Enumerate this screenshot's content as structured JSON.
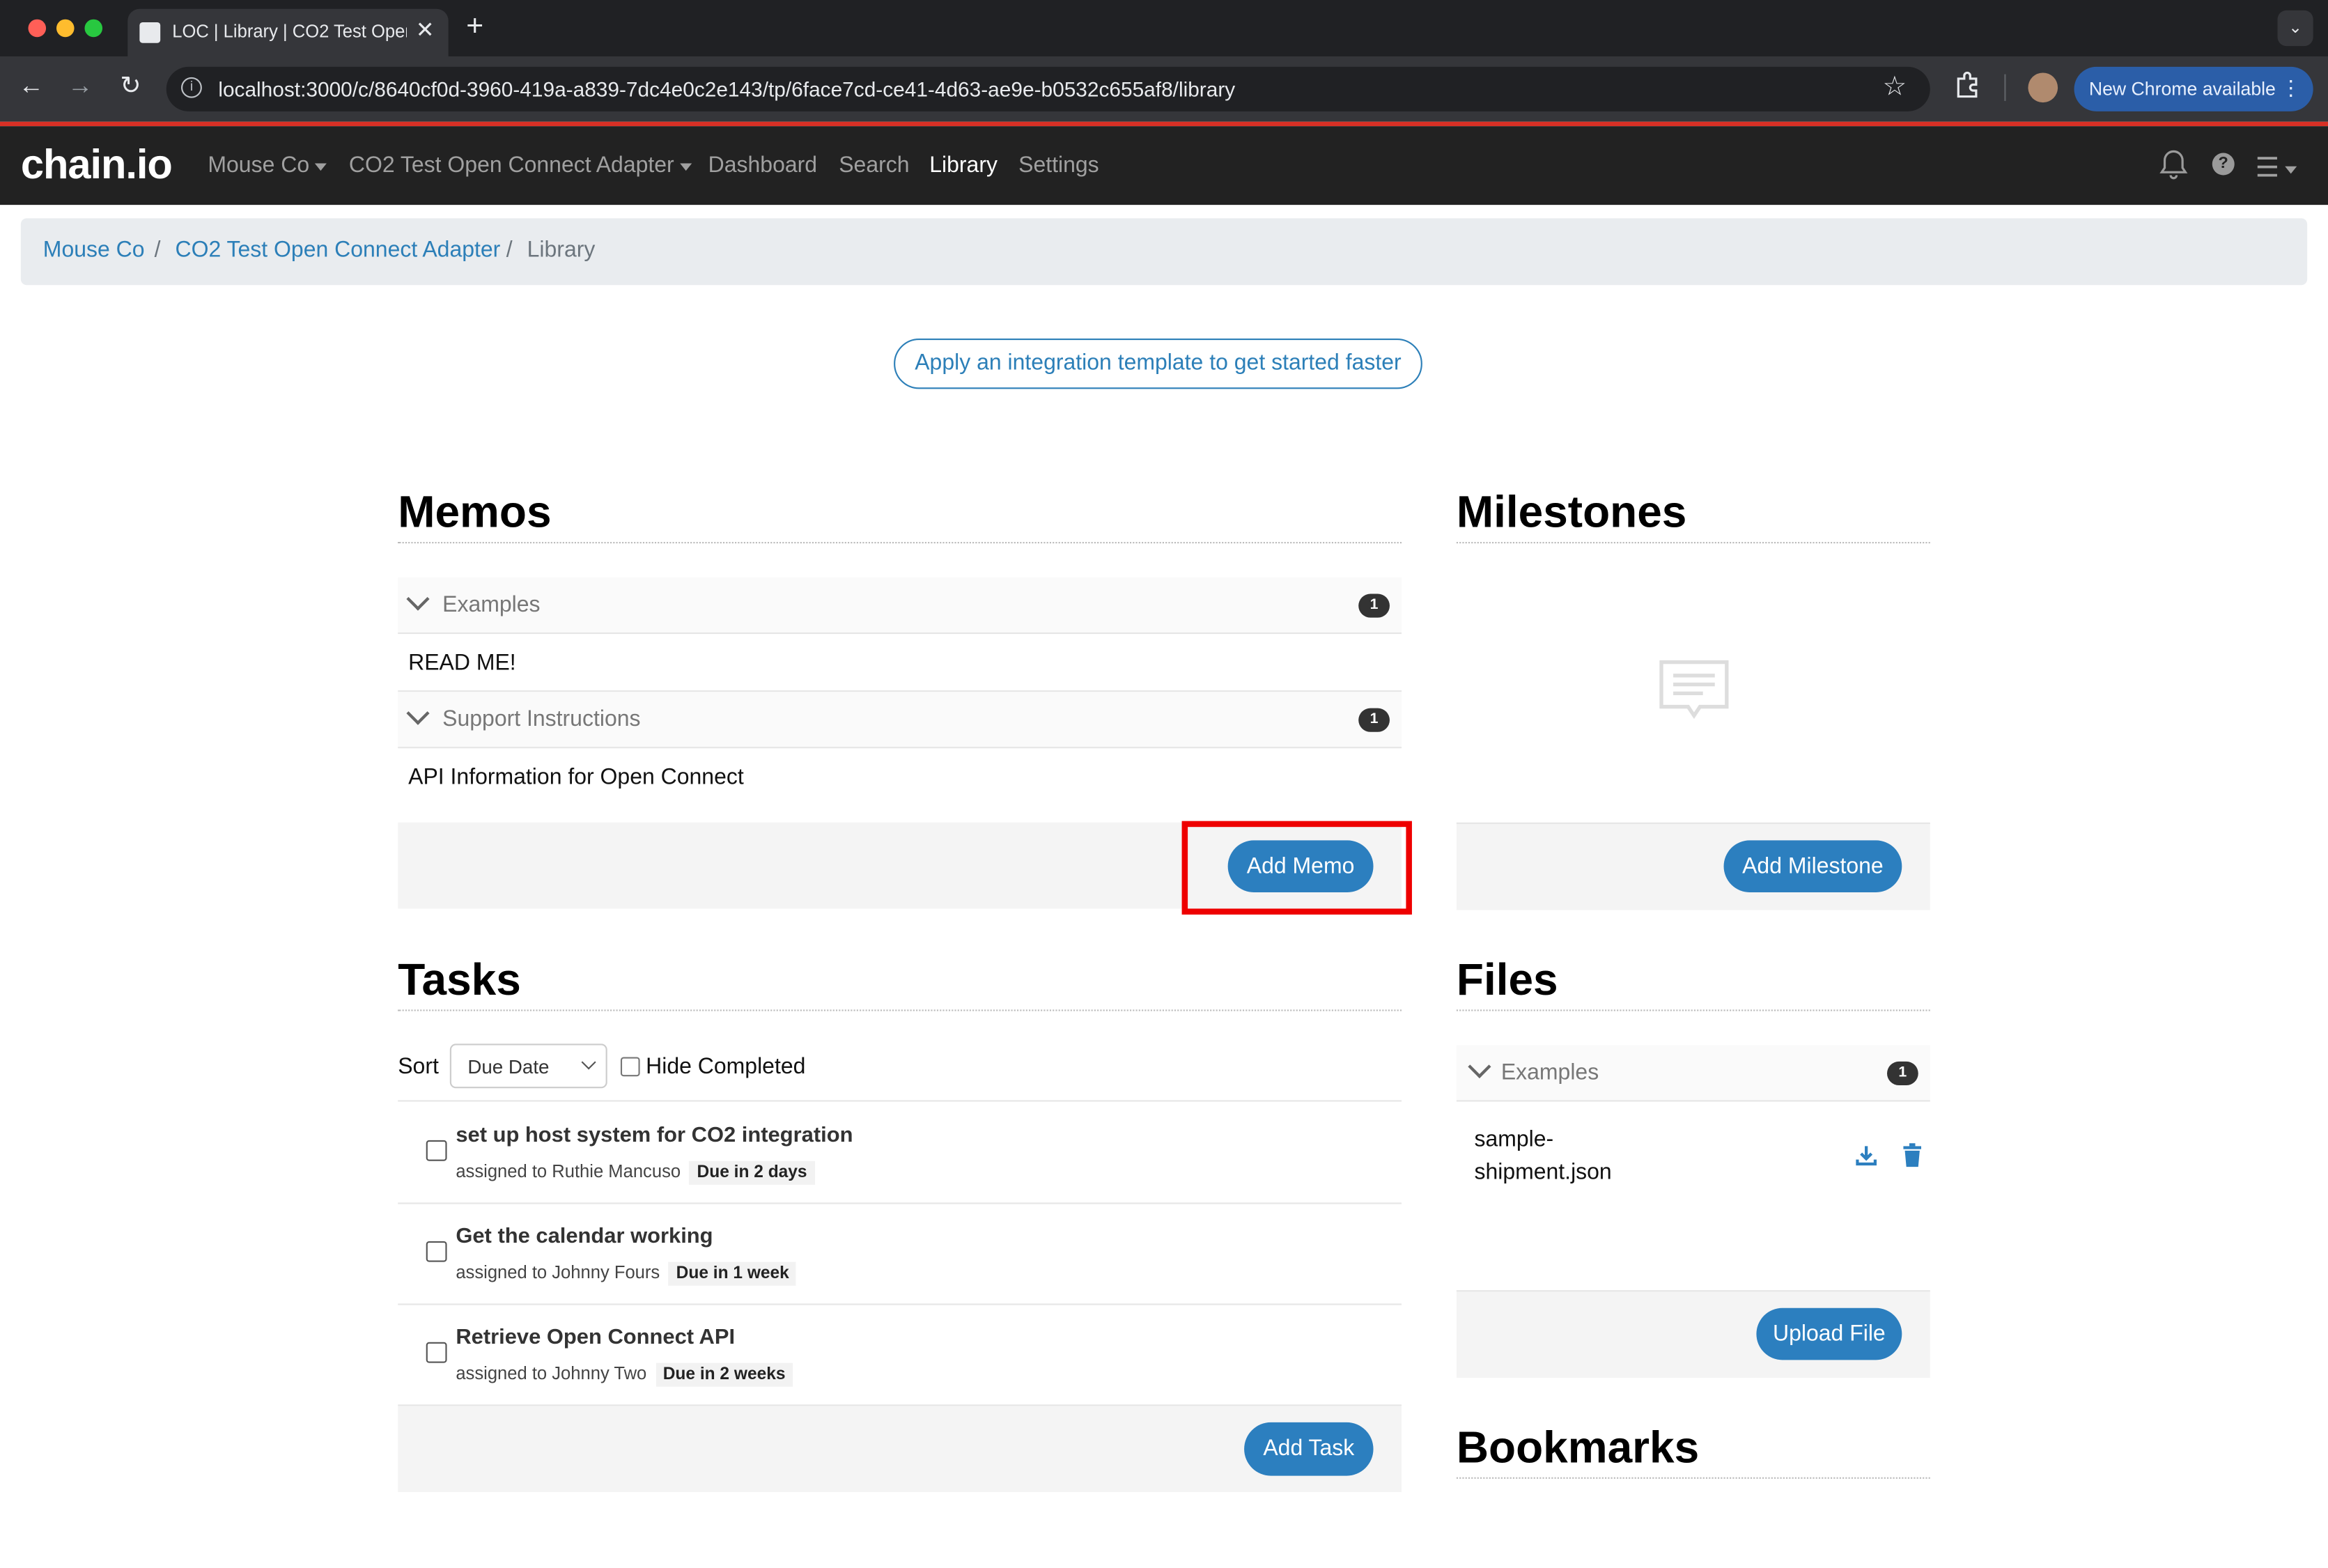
{
  "browser": {
    "tab_title": "LOC | Library | CO2 Test Open Connect Adapter",
    "url": "localhost:3000/c/8640cf0d-3960-419a-a839-7dc4e0c2e143/tp/6face7cd-ce41-4d63-ae9e-b0532c655af8/library",
    "update_label": "New Chrome available"
  },
  "nav": {
    "logo": "chain.io",
    "company": "Mouse Co",
    "partner": "CO2 Test Open Connect Adapter",
    "dashboard": "Dashboard",
    "search": "Search",
    "library": "Library",
    "settings": "Settings"
  },
  "breadcrumb": {
    "company": "Mouse Co",
    "partner": "CO2 Test Open Connect Adapter",
    "current": "Library",
    "sep": "/"
  },
  "template_button": "Apply an integration template to get started faster",
  "memos": {
    "heading": "Memos",
    "groups": [
      {
        "label": "Examples",
        "count": "1",
        "items": [
          "READ ME!"
        ]
      },
      {
        "label": "Support Instructions",
        "count": "1",
        "items": [
          "API Information for Open Connect"
        ]
      }
    ],
    "add_label": "Add Memo"
  },
  "milestones": {
    "heading": "Milestones",
    "add_label": "Add Milestone"
  },
  "tasks": {
    "heading": "Tasks",
    "sort_label": "Sort",
    "sort_value": "Due Date",
    "hide_completed": "Hide Completed",
    "items": [
      {
        "title": "set up host system for CO2 integration",
        "assignee": "assigned to Ruthie Mancuso",
        "due": "Due in 2 days"
      },
      {
        "title": "Get the calendar working",
        "assignee": "assigned to Johnny Fours",
        "due": "Due in 1 week"
      },
      {
        "title": "Retrieve Open Connect API",
        "assignee": "assigned to Johnny Two",
        "due": "Due in 2 weeks"
      }
    ],
    "add_label": "Add Task"
  },
  "files": {
    "heading": "Files",
    "group_label": "Examples",
    "group_count": "1",
    "file_line1": "sample-",
    "file_line2": "shipment.json",
    "upload_label": "Upload File"
  },
  "bookmarks": {
    "heading": "Bookmarks"
  },
  "colors": {
    "accent": "#2c7fbf",
    "highlight": "#e00000",
    "nav_bg": "#222222"
  }
}
